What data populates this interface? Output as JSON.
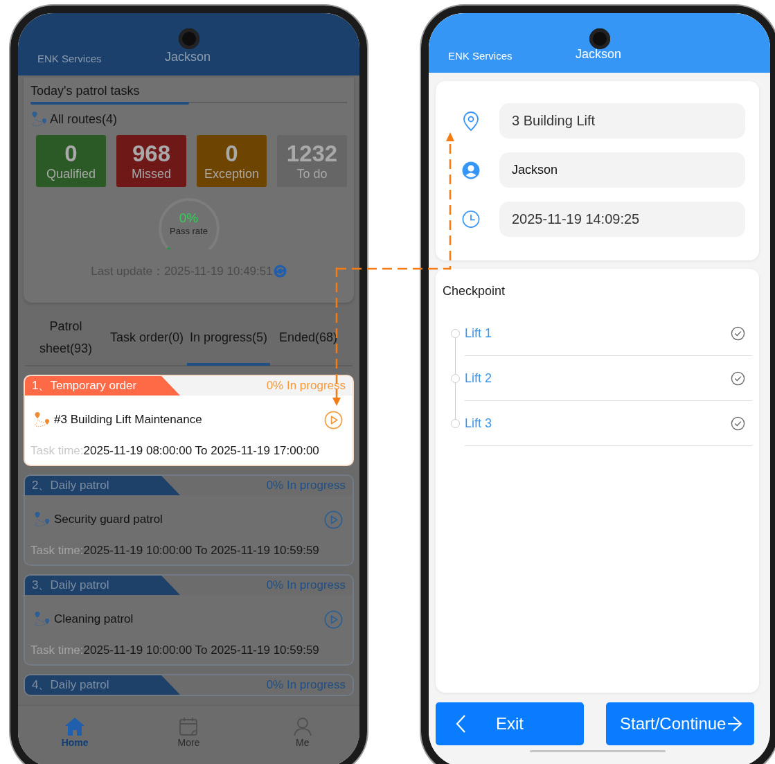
{
  "left_screen": {
    "header": {
      "brand": "ENK Services",
      "user": "Jackson"
    },
    "title": "Today's patrol tasks",
    "routes_label": "All routes(4)",
    "stats": [
      {
        "value": "0",
        "label": "Qualified",
        "color": "#2b5a26"
      },
      {
        "value": "968",
        "label": "Missed",
        "color": "#6e1818"
      },
      {
        "value": "0",
        "label": "Exception",
        "color": "#6d4400"
      },
      {
        "value": "1232",
        "label": "To do",
        "color": "#666666"
      }
    ],
    "gauge": {
      "value": "0%",
      "label": "Pass rate"
    },
    "last_update": "Last update：2025-11-19 10:49:51",
    "tabs": [
      {
        "label": "Patrol sheet(93)",
        "selected": false
      },
      {
        "label": "Task order(0)",
        "selected": false
      },
      {
        "label": "In progress(5)",
        "selected": true
      },
      {
        "label": "Ended(68)",
        "selected": false
      }
    ],
    "tasks": [
      {
        "tag": "1、Temporary order",
        "status": "0% In progress",
        "name": "#3 Building Lift Maintenance",
        "time_label": "Task time:",
        "time": "2025-11-19 08:00:00 To 2025-11-19 17:00:00",
        "highlighted": true
      },
      {
        "tag": "2、Daily patrol",
        "status": "0% In progress",
        "name": "Security guard patrol",
        "time_label": "Task time:",
        "time": "2025-11-19 10:00:00 To 2025-11-19 10:59:59",
        "highlighted": false
      },
      {
        "tag": "3、Daily patrol",
        "status": "0% In progress",
        "name": "Cleaning patrol",
        "time_label": "Task time:",
        "time": "2025-11-19 10:00:00 To 2025-11-19 10:59:59",
        "highlighted": false
      },
      {
        "tag": "4、Daily patrol",
        "status": "0% In progress",
        "highlighted": false
      }
    ],
    "nav": [
      {
        "label": "Home",
        "kind": "home",
        "selected": true
      },
      {
        "label": "More",
        "kind": "calendar",
        "selected": false
      },
      {
        "label": "Me",
        "kind": "person",
        "selected": false
      }
    ]
  },
  "right_screen": {
    "header": {
      "brand": "ENK Services",
      "user": "Jackson"
    },
    "fields": [
      {
        "kind": "location",
        "value": "3 Building Lift"
      },
      {
        "kind": "person",
        "value": "Jackson"
      },
      {
        "kind": "clock",
        "value": "2025-11-19 14:09:25"
      }
    ],
    "checkpoint_title": "Checkpoint",
    "checkpoints": [
      {
        "label": "Lift 1"
      },
      {
        "label": "Lift 2"
      },
      {
        "label": "Lift 3"
      }
    ],
    "buttons": [
      {
        "label": "Exit",
        "kind": "back"
      },
      {
        "label": "Start/Continue",
        "kind": "forward"
      }
    ]
  }
}
